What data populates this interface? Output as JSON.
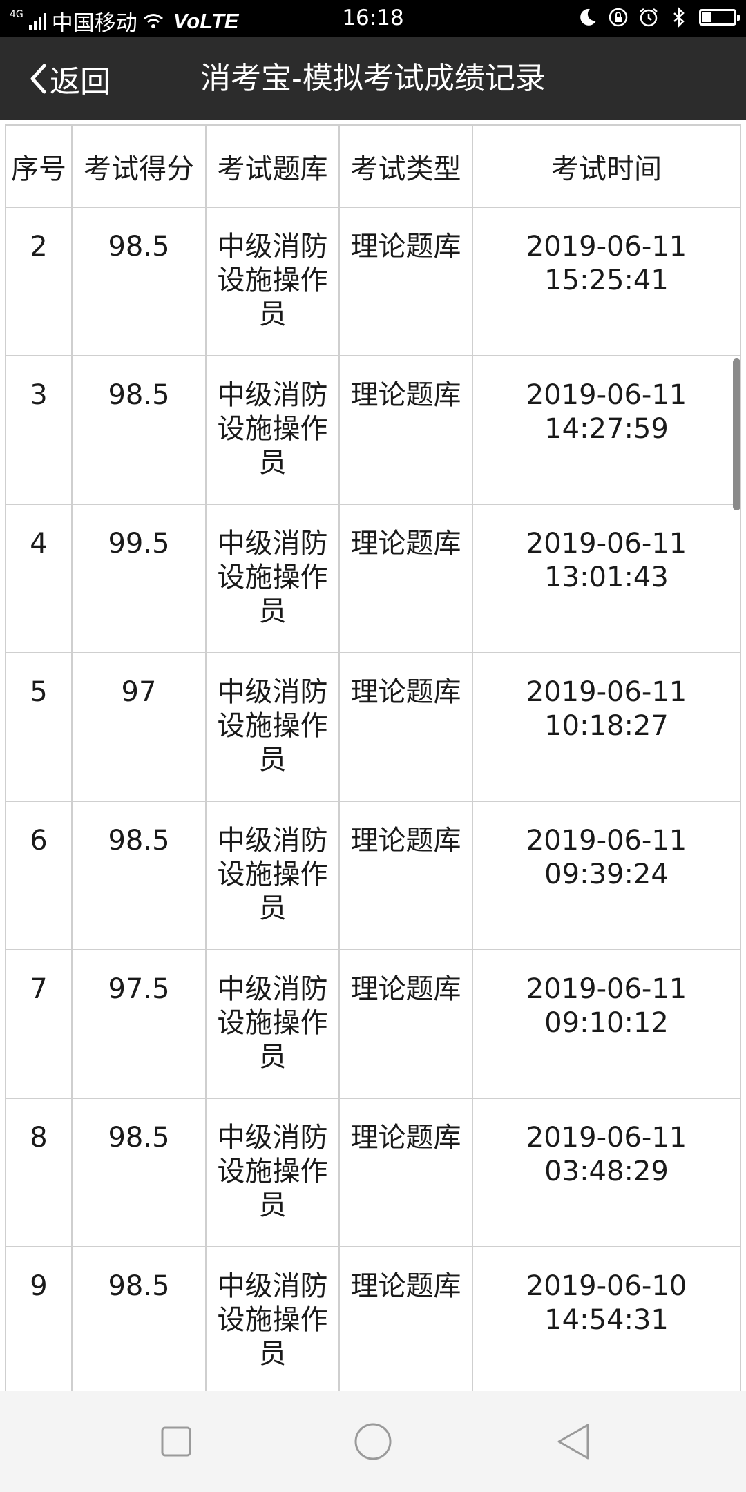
{
  "status_bar": {
    "network_type": "4G",
    "carrier": "中国移动",
    "volte": "VoLTE",
    "time": "16:18",
    "battery_level": 0.3
  },
  "header": {
    "back_label": "返回",
    "title": "消考宝-模拟考试成绩记录"
  },
  "table": {
    "columns": [
      "序号",
      "考试得分",
      "考试题库",
      "考试类型",
      "考试时间"
    ],
    "rows": [
      {
        "index": "2",
        "score": "98.5",
        "bank": "中级消防设施操作员",
        "type": "理论题库",
        "date": "2019-06-11",
        "time": "15:25:41"
      },
      {
        "index": "3",
        "score": "98.5",
        "bank": "中级消防设施操作员",
        "type": "理论题库",
        "date": "2019-06-11",
        "time": "14:27:59"
      },
      {
        "index": "4",
        "score": "99.5",
        "bank": "中级消防设施操作员",
        "type": "理论题库",
        "date": "2019-06-11",
        "time": "13:01:43"
      },
      {
        "index": "5",
        "score": "97",
        "bank": "中级消防设施操作员",
        "type": "理论题库",
        "date": "2019-06-11",
        "time": "10:18:27"
      },
      {
        "index": "6",
        "score": "98.5",
        "bank": "中级消防设施操作员",
        "type": "理论题库",
        "date": "2019-06-11",
        "time": "09:39:24"
      },
      {
        "index": "7",
        "score": "97.5",
        "bank": "中级消防设施操作员",
        "type": "理论题库",
        "date": "2019-06-11",
        "time": "09:10:12"
      },
      {
        "index": "8",
        "score": "98.5",
        "bank": "中级消防设施操作员",
        "type": "理论题库",
        "date": "2019-06-11",
        "time": "03:48:29"
      },
      {
        "index": "9",
        "score": "98.5",
        "bank": "中级消防设施操作员",
        "type": "理论题库",
        "date": "2019-06-10",
        "time": "14:54:31"
      }
    ]
  },
  "nav_bar": {
    "icons": [
      "recent-apps-icon",
      "home-icon",
      "back-triangle-icon"
    ]
  },
  "colors": {
    "title_bar": "#2c2c2c",
    "status_bar": "#000000",
    "grid_line": "#cfcfcf",
    "nav_bar": "#f4f4f4"
  }
}
